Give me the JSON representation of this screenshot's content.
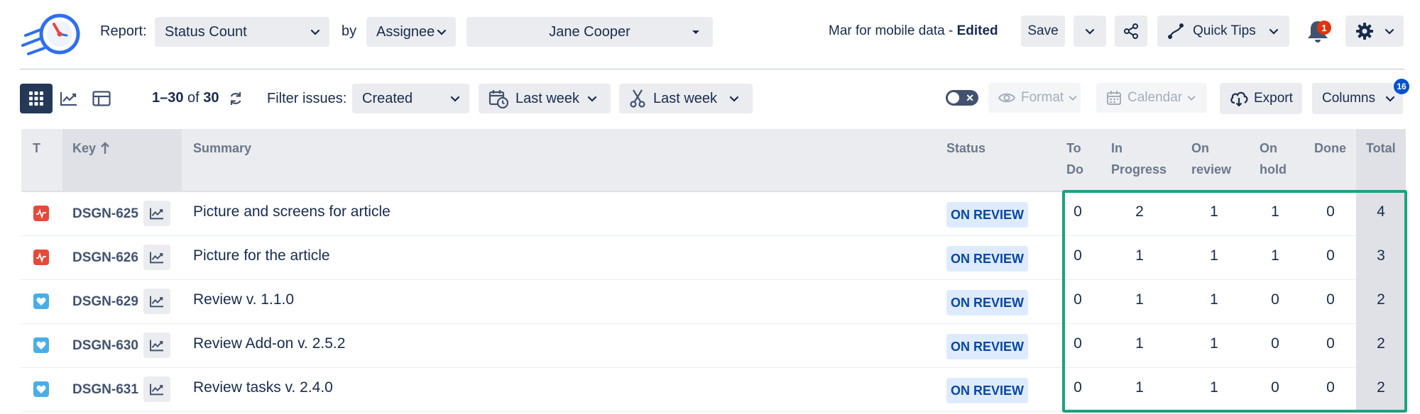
{
  "header": {
    "report_label": "Report:",
    "report_type": "Status Count",
    "by_label": "by",
    "group_by": "Assignee",
    "person": "Jane Cooper",
    "report_name": "Mar for mobile data - ",
    "report_state": "Edited",
    "save_label": "Save",
    "quick_tips_label": "Quick Tips",
    "notification_count": "1"
  },
  "toolbar": {
    "views": [
      "grid-view-icon",
      "chart-view-icon",
      "layout-view-icon"
    ],
    "range_start": "1",
    "range_dash": "–",
    "range_end": "30",
    "of_label": " of ",
    "total": "30",
    "filter_label": "Filter issues:",
    "filter_field": "Created",
    "date_filter_1": "Last week",
    "date_filter_2": "Last week",
    "format_label": "Format",
    "calendar_label": "Calendar",
    "export_label": "Export",
    "columns_label": "Columns",
    "columns_count": "16"
  },
  "table": {
    "columns": {
      "type": "T",
      "key": "Key",
      "summary": "Summary",
      "status": "Status",
      "todo_1": "To",
      "todo_2": "Do",
      "progress_1": "In",
      "progress_2": "Progress",
      "review_1": "On",
      "review_2": "review",
      "hold_1": "On",
      "hold_2": "hold",
      "done": "Done",
      "total": "Total"
    },
    "rows": [
      {
        "type": "bug",
        "key": "DSGN-625",
        "summary": "Picture and screens for article",
        "status": "ON REVIEW",
        "todo": "0",
        "progress": "2",
        "review": "1",
        "hold": "1",
        "done": "0",
        "total": "4"
      },
      {
        "type": "bug",
        "key": "DSGN-626",
        "summary": "Picture for the article",
        "status": "ON REVIEW",
        "todo": "0",
        "progress": "1",
        "review": "1",
        "hold": "1",
        "done": "0",
        "total": "3"
      },
      {
        "type": "feedback",
        "key": "DSGN-629",
        "summary": "Review v. 1.1.0",
        "status": "ON REVIEW",
        "todo": "0",
        "progress": "1",
        "review": "1",
        "hold": "0",
        "done": "0",
        "total": "2"
      },
      {
        "type": "feedback",
        "key": "DSGN-630",
        "summary": "Review Add-on v. 2.5.2",
        "status": "ON REVIEW",
        "todo": "0",
        "progress": "1",
        "review": "1",
        "hold": "0",
        "done": "0",
        "total": "2"
      },
      {
        "type": "feedback",
        "key": "DSGN-631",
        "summary": "Review tasks v. 2.4.0",
        "status": "ON REVIEW",
        "todo": "0",
        "progress": "1",
        "review": "1",
        "hold": "0",
        "done": "0",
        "total": "2"
      }
    ]
  },
  "colors": {
    "accent_dark": "#253858",
    "status_bg": "#deebff",
    "status_text": "#0747a6",
    "highlight": "#1aa380",
    "bug": "#e5493a",
    "feedback": "#4bade8",
    "badge_red": "#de350b",
    "badge_blue": "#0052cc"
  }
}
